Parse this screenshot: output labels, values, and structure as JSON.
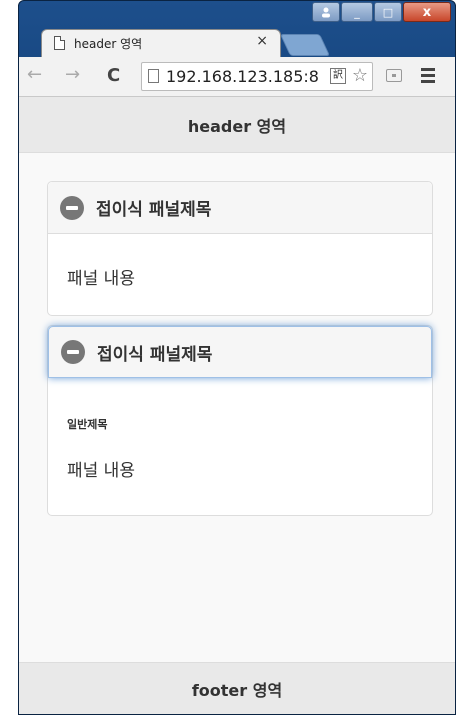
{
  "browser": {
    "tab_title": "header 영역",
    "tab_close": "×",
    "url": "192.168.123.185:8",
    "translate_glyph": "訳",
    "close_glyph": "x",
    "min_glyph": "_",
    "max_glyph": "□",
    "back_glyph": "←",
    "forward_glyph": "→",
    "reload_glyph": "C",
    "star_glyph": "☆"
  },
  "header": {
    "title": "header 영역"
  },
  "panels": [
    {
      "title": "접이식 패널제목",
      "body": "패널 내용"
    },
    {
      "title": "접이식 패널제목",
      "subtitle": "일반제목",
      "body": "패널 내용"
    }
  ],
  "footer": {
    "title": "footer 영역"
  }
}
